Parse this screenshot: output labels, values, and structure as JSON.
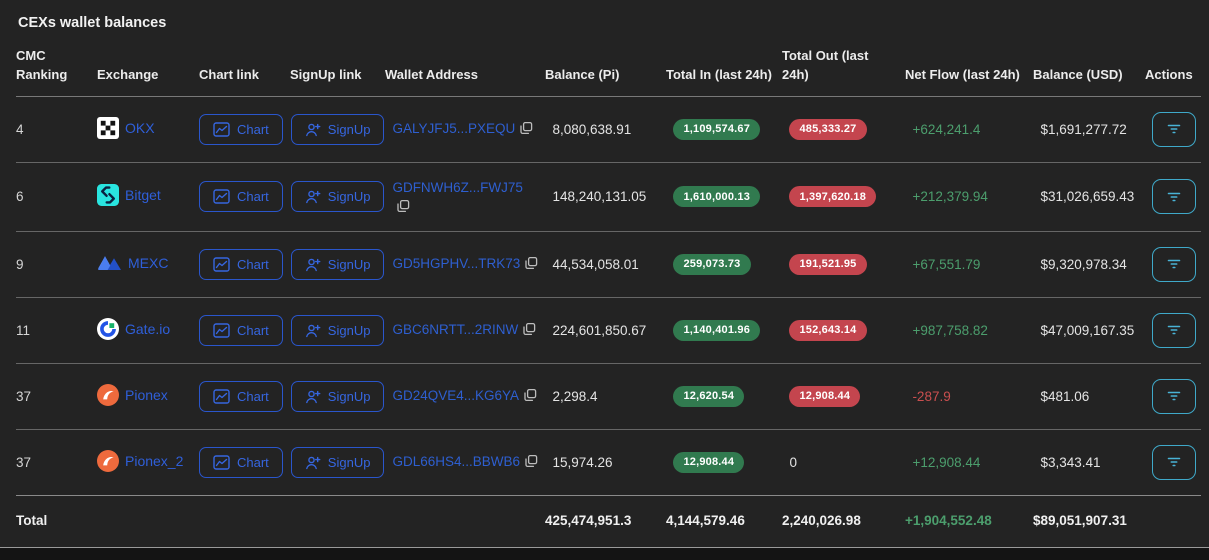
{
  "title": "CEXs wallet balances",
  "columns": {
    "ranking": "CMC Ranking",
    "exchange": "Exchange",
    "chart_link": "Chart link",
    "signup_link": "SignUp link",
    "wallet_address": "Wallet Address",
    "balance_pi": "Balance (Pi)",
    "total_in": "Total In (last 24h)",
    "total_out": "Total Out (last 24h)",
    "net_flow": "Net Flow (last 24h)",
    "balance_usd": "Balance (USD)",
    "actions": "Actions"
  },
  "buttons": {
    "chart_label": "Chart",
    "signup_label": "SignUp"
  },
  "icons": {
    "chart": "line-chart-icon",
    "signup": "person-plus-icon",
    "copy": "copy-icon",
    "actions": "filter-icon"
  },
  "rows": [
    {
      "ranking": "4",
      "exchange_name": "OKX",
      "logo_icon": "okx-logo",
      "wallet_address": "GALYJFJ5...PXEQU",
      "balance_pi": "8,080,638.91",
      "total_in": "1,109,574.67",
      "total_out": "485,333.27",
      "total_out_badge": true,
      "net_flow": "+624,241.4",
      "net_flow_positive": true,
      "balance_usd": "$1,691,277.72"
    },
    {
      "ranking": "6",
      "exchange_name": "Bitget",
      "logo_icon": "bitget-logo",
      "wallet_address": "GDFNWH6Z...FWJ75",
      "balance_pi": "148,240,131.05",
      "total_in": "1,610,000.13",
      "total_out": "1,397,620.18",
      "total_out_badge": true,
      "net_flow": "+212,379.94",
      "net_flow_positive": true,
      "balance_usd": "$31,026,659.43"
    },
    {
      "ranking": "9",
      "exchange_name": "MEXC",
      "logo_icon": "mexc-logo",
      "wallet_address": "GD5HGPHV...TRK73",
      "balance_pi": "44,534,058.01",
      "total_in": "259,073.73",
      "total_out": "191,521.95",
      "total_out_badge": true,
      "net_flow": "+67,551.79",
      "net_flow_positive": true,
      "balance_usd": "$9,320,978.34"
    },
    {
      "ranking": "11",
      "exchange_name": "Gate.io",
      "logo_icon": "gateio-logo",
      "wallet_address": "GBC6NRTT...2RINW",
      "balance_pi": "224,601,850.67",
      "total_in": "1,140,401.96",
      "total_out": "152,643.14",
      "total_out_badge": true,
      "net_flow": "+987,758.82",
      "net_flow_positive": true,
      "balance_usd": "$47,009,167.35"
    },
    {
      "ranking": "37",
      "exchange_name": "Pionex",
      "logo_icon": "pionex-logo",
      "wallet_address": "GD24QVE4...KG6YA",
      "balance_pi": "2,298.4",
      "total_in": "12,620.54",
      "total_out": "12,908.44",
      "total_out_badge": true,
      "net_flow": "-287.9",
      "net_flow_positive": false,
      "balance_usd": "$481.06"
    },
    {
      "ranking": "37",
      "exchange_name": "Pionex_2",
      "logo_icon": "pionex-logo",
      "wallet_address": "GDL66HS4...BBWB6",
      "balance_pi": "15,974.26",
      "total_in": "12,908.44",
      "total_out": "0",
      "total_out_badge": false,
      "net_flow": "+12,908.44",
      "net_flow_positive": true,
      "balance_usd": "$3,343.41"
    }
  ],
  "total_row": {
    "label": "Total",
    "balance_pi": "425,474,951.3",
    "total_in": "4,144,579.46",
    "total_out": "2,240,026.98",
    "net_flow": "+1,904,552.48",
    "net_flow_positive": true,
    "balance_usd": "$89,051,907.31"
  },
  "colors": {
    "card_background": "#232323",
    "page_background": "#141414",
    "link_blue": "#2f5fd9",
    "button_border_blue": "#2a56cc",
    "badge_green": "#317a4f",
    "badge_red": "#c4454e",
    "net_positive_green": "#4c9e6d",
    "net_negative_red": "#c94f4f",
    "actions_teal": "#3fa9c9"
  }
}
